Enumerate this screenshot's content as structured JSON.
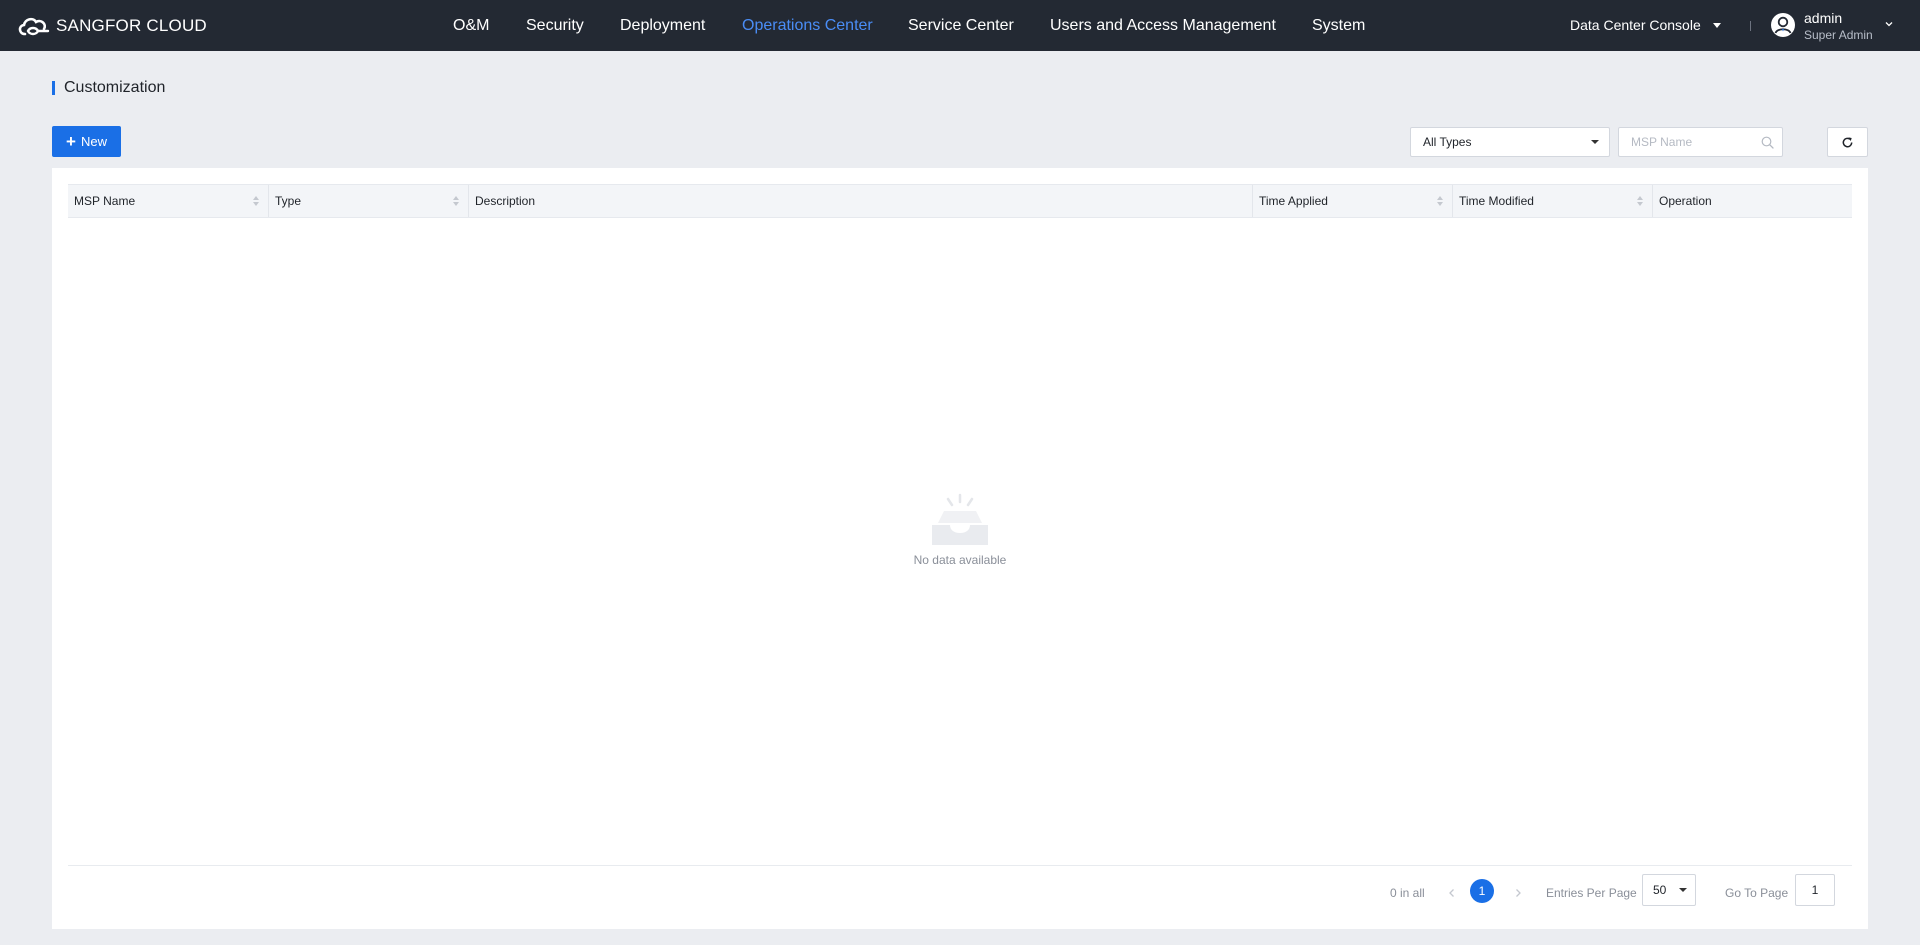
{
  "brand": {
    "name": "SANGFOR CLOUD"
  },
  "nav": {
    "items": [
      {
        "label": "O&M"
      },
      {
        "label": "Security"
      },
      {
        "label": "Deployment"
      },
      {
        "label": "Operations Center",
        "active": true
      },
      {
        "label": "Service Center"
      },
      {
        "label": "Users and Access Management"
      },
      {
        "label": "System"
      }
    ]
  },
  "header": {
    "console_label": "Data Center Console",
    "user_name": "admin",
    "user_role": "Super Admin"
  },
  "page": {
    "title": "Customization"
  },
  "toolbar": {
    "new_label": "New",
    "type_filter_value": "All Types",
    "search_placeholder": "MSP Name"
  },
  "table": {
    "columns": [
      {
        "label": "MSP Name",
        "sortable": true
      },
      {
        "label": "Type",
        "sortable": true
      },
      {
        "label": "Description",
        "sortable": false
      },
      {
        "label": "Time Applied",
        "sortable": true
      },
      {
        "label": "Time Modified",
        "sortable": true
      },
      {
        "label": "Operation",
        "sortable": false
      }
    ],
    "rows": [],
    "empty_text": "No data available"
  },
  "pagination": {
    "total_text": "0 in all",
    "current_page": "1",
    "entries_label": "Entries Per Page",
    "entries_value": "50",
    "goto_label": "Go To Page",
    "goto_value": "1"
  },
  "colors": {
    "topbar_bg": "#232933",
    "accent": "#1a6fe6",
    "active_nav": "#4a8df6",
    "page_bg": "#ebedf1"
  }
}
